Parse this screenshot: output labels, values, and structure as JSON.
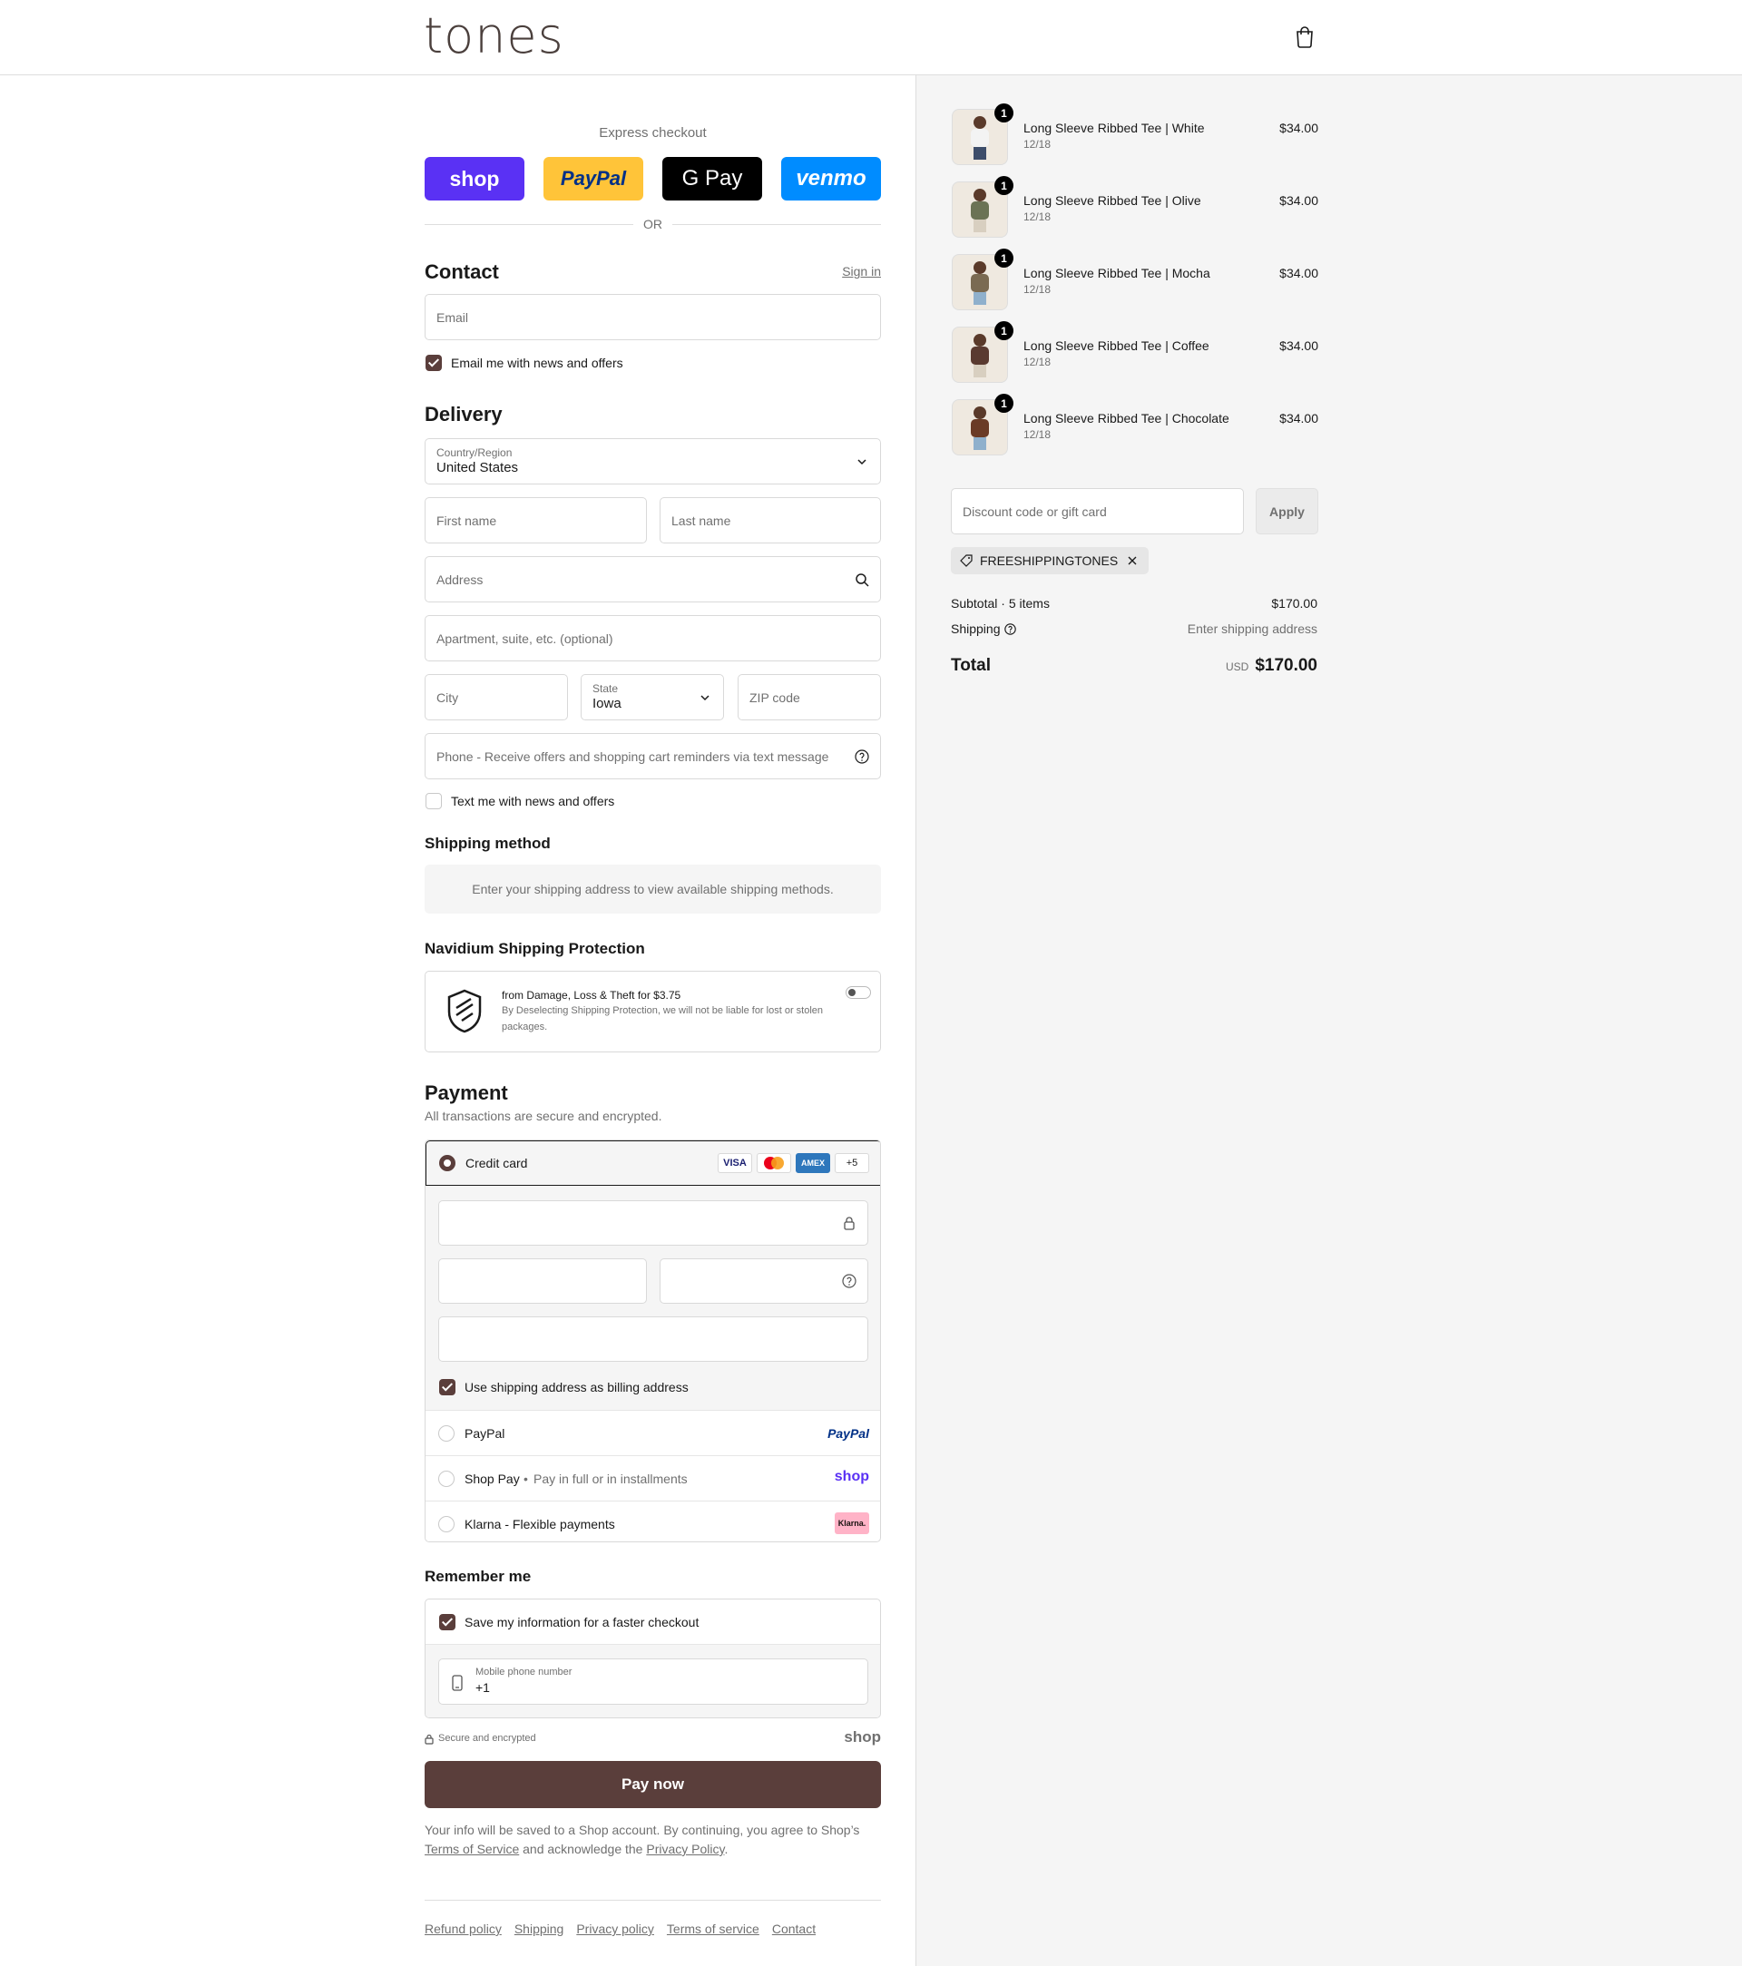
{
  "header": {
    "logo": "tones"
  },
  "express": {
    "label": "Express checkout",
    "buttons": {
      "shop": "shop",
      "paypal": "PayPal",
      "gpay": "G Pay",
      "venmo": "venmo"
    },
    "or": "OR"
  },
  "contact": {
    "title": "Contact",
    "signin": "Sign in",
    "email_placeholder": "Email",
    "news_label": "Email me with news and offers"
  },
  "delivery": {
    "title": "Delivery",
    "country_label": "Country/Region",
    "country_value": "United States",
    "first_name": "First name",
    "last_name": "Last name",
    "address": "Address",
    "apartment": "Apartment, suite, etc. (optional)",
    "city": "City",
    "state_label": "State",
    "state_value": "Iowa",
    "zip": "ZIP code",
    "phone": "Phone - Receive offers and shopping cart reminders via text message",
    "text_label": "Text me with news and offers"
  },
  "shipping_method": {
    "title": "Shipping method",
    "info": "Enter your shipping address to view available shipping methods."
  },
  "protection": {
    "title": "Navidium Shipping Protection",
    "headline": "from Damage, Loss & Theft for $3.75",
    "desc_line1": "By Deselecting Shipping Protection, we will not be liable for lost or stolen",
    "desc_line2": "packages."
  },
  "payment": {
    "title": "Payment",
    "subtitle": "All transactions are secure and encrypted.",
    "credit_card": "Credit card",
    "badges": {
      "visa": "VISA",
      "amex": "AMEX",
      "more": "+5"
    },
    "billing_label": "Use shipping address as billing address",
    "paypal": "PayPal",
    "paypal_logo": "PayPal",
    "shoppay": "Shop Pay",
    "shoppay_sub": "Pay in full or in installments",
    "shoppay_logo": "shop",
    "klarna": "Klarna - Flexible payments",
    "klarna_logo": "Klarna."
  },
  "remember": {
    "title": "Remember me",
    "save_label": "Save my information for a faster checkout",
    "mobile_label": "Mobile phone number",
    "mobile_value": "+1",
    "secure": "Secure and encrypted",
    "shop_logo": "shop"
  },
  "pay_now": "Pay now",
  "legal": {
    "line1": "Your info will be saved to a Shop account. By continuing, you agree to Shop’s",
    "terms": "Terms of Service",
    "mid": " and acknowledge the ",
    "privacy": "Privacy Policy",
    "end": "."
  },
  "footer_links": [
    "Refund policy",
    "Shipping",
    "Privacy policy",
    "Terms of service",
    "Contact"
  ],
  "cart": {
    "items": [
      {
        "name": "Long Sleeve Ribbed Tee | White",
        "variant": "12/18",
        "price": "$34.00",
        "qty": "1",
        "color": "#f3f3f3"
      },
      {
        "name": "Long Sleeve Ribbed Tee | Olive",
        "variant": "12/18",
        "price": "$34.00",
        "qty": "1",
        "color": "#6b7355"
      },
      {
        "name": "Long Sleeve Ribbed Tee | Mocha",
        "variant": "12/18",
        "price": "$34.00",
        "qty": "1",
        "color": "#7a6a52"
      },
      {
        "name": "Long Sleeve Ribbed Tee | Coffee",
        "variant": "12/18",
        "price": "$34.00",
        "qty": "1",
        "color": "#5a3a30"
      },
      {
        "name": "Long Sleeve Ribbed Tee | Chocolate",
        "variant": "12/18",
        "price": "$34.00",
        "qty": "1",
        "color": "#6a3b26"
      }
    ],
    "discount_placeholder": "Discount code or gift card",
    "apply": "Apply",
    "code": "FREESHIPPINGTONES",
    "subtotal_label": "Subtotal · 5 items",
    "subtotal_value": "$170.00",
    "shipping_label": "Shipping",
    "shipping_value": "Enter shipping address",
    "total_label": "Total",
    "currency": "USD",
    "total_value": "$170.00"
  },
  "colors": {
    "accent": "#5a3e3b",
    "shop": "#5a31f4",
    "paypal": "#ffc439",
    "venmo": "#008cff"
  }
}
